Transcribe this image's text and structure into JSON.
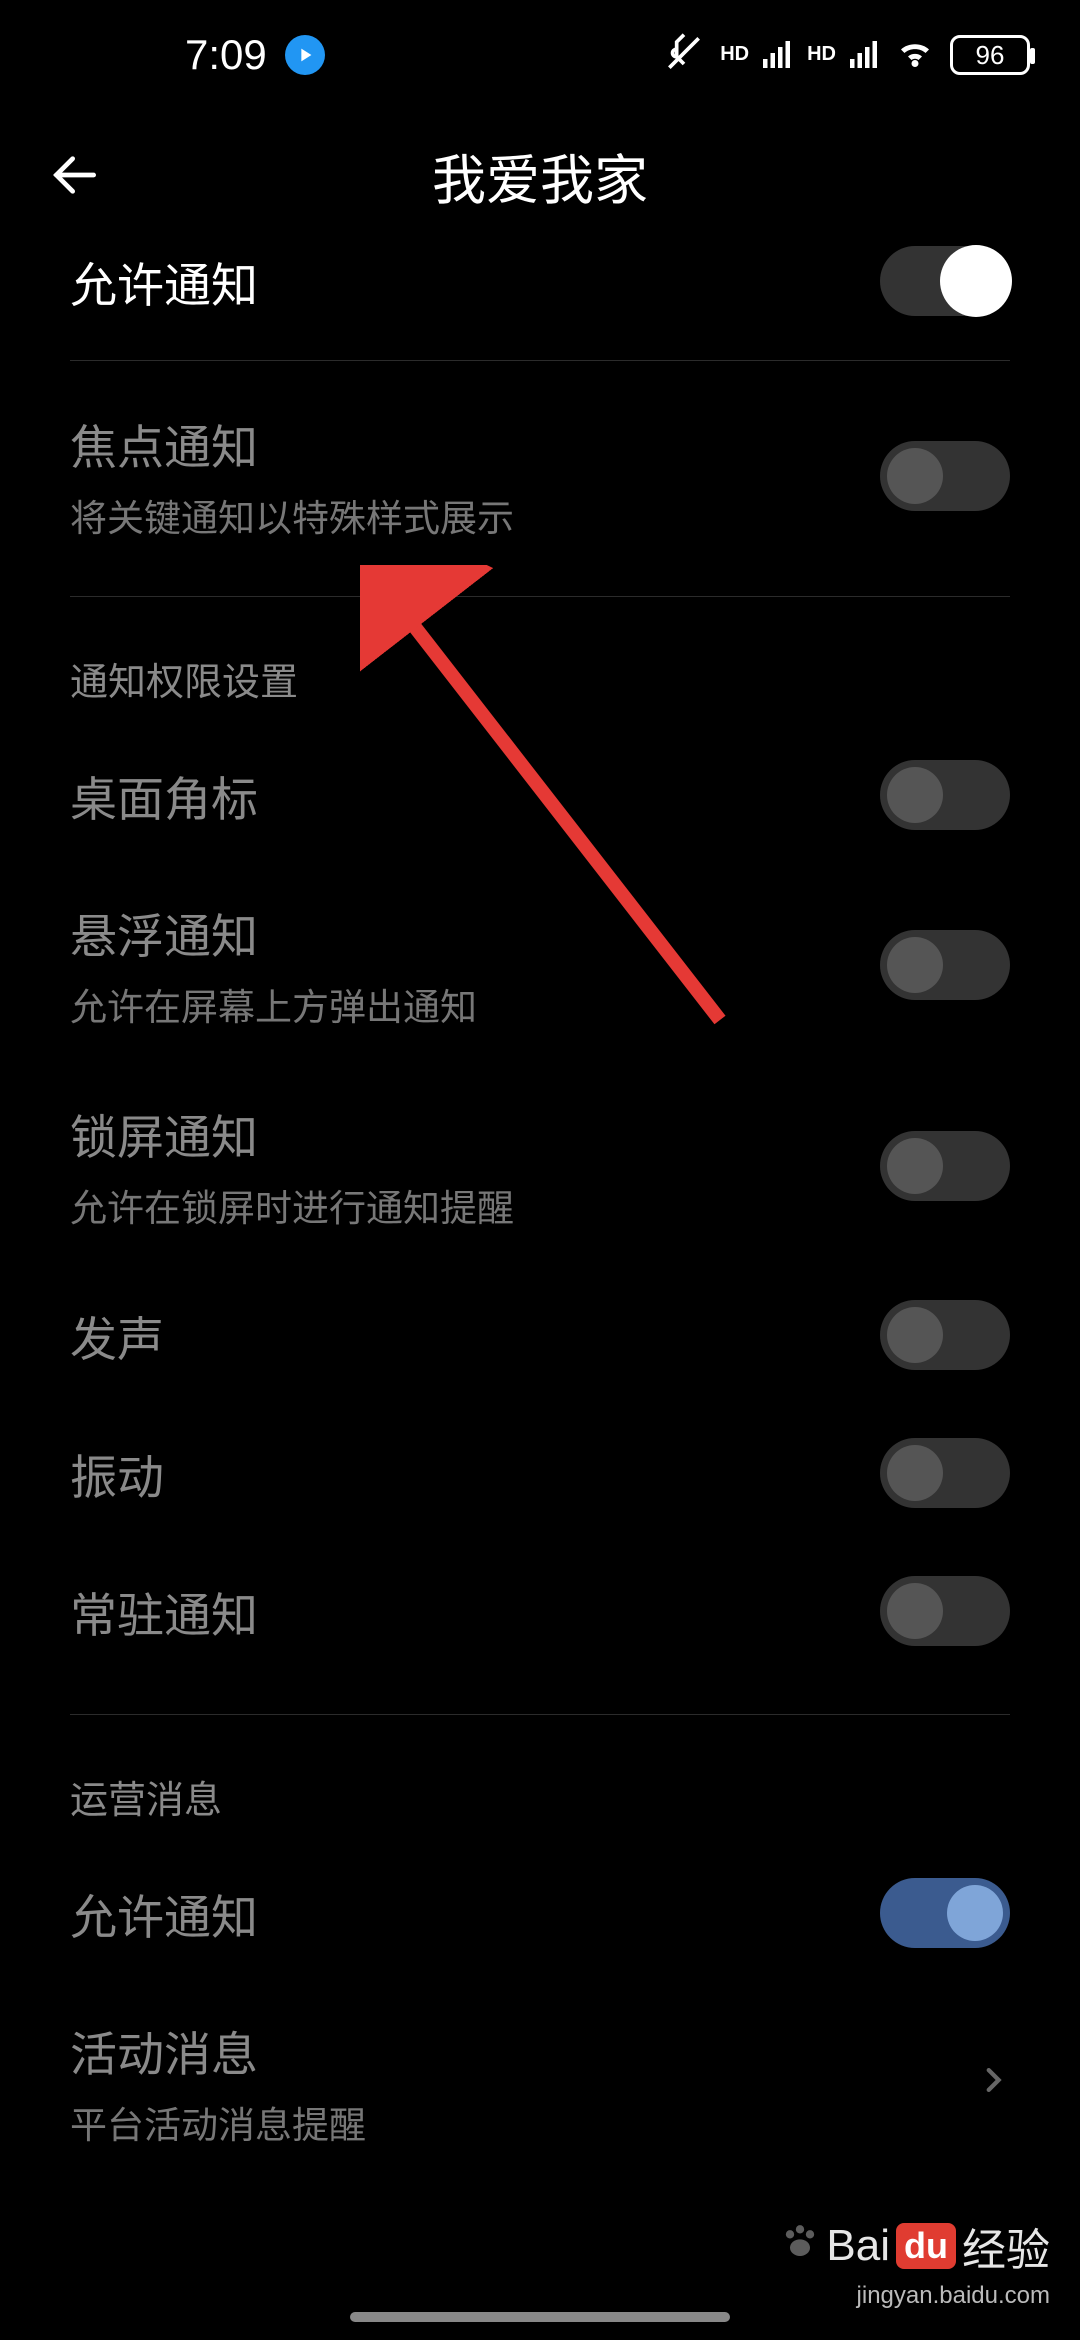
{
  "status": {
    "time": "7:09",
    "battery": "96"
  },
  "header": {
    "title": "我爱我家"
  },
  "rows": {
    "allow_notify_top": {
      "title": "允许通知"
    },
    "focus_notify": {
      "title": "焦点通知",
      "sub": "将关键通知以特殊样式展示"
    }
  },
  "section1": {
    "header": "通知权限设置",
    "badge": {
      "title": "桌面角标"
    },
    "floating": {
      "title": "悬浮通知",
      "sub": "允许在屏幕上方弹出通知"
    },
    "lockscreen": {
      "title": "锁屏通知",
      "sub": "允许在锁屏时进行通知提醒"
    },
    "sound": {
      "title": "发声"
    },
    "vibrate": {
      "title": "振动"
    },
    "persistent": {
      "title": "常驻通知"
    }
  },
  "section2": {
    "header": "运营消息",
    "allow": {
      "title": "允许通知"
    },
    "activity": {
      "title": "活动消息",
      "sub": "平台活动消息提醒"
    }
  },
  "watermark": {
    "brand_pre": "Bai",
    "brand_box": "du",
    "brand_post": "经验",
    "url": "jingyan.baidu.com"
  }
}
